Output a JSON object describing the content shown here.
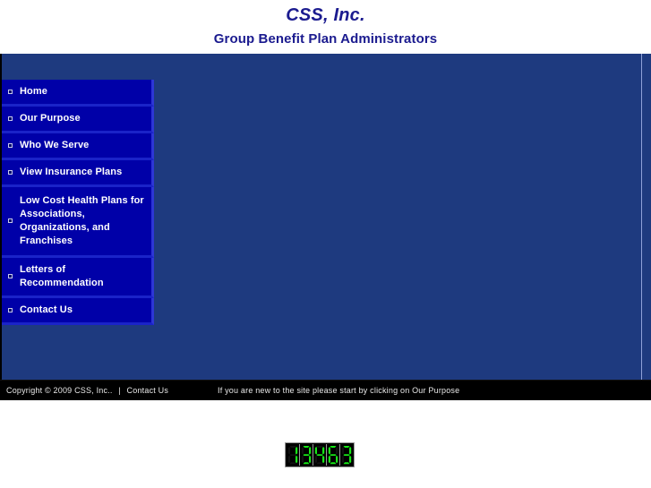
{
  "header": {
    "title": "CSS, Inc.",
    "tagline": "Group Benefit Plan Administrators",
    "title_color": "#1b1b8f"
  },
  "theme": {
    "page_background": "#1e3a7f",
    "nav_item_background": "#0000a8",
    "nav_item_border": "#2d36d6",
    "footer_background": "#000000",
    "counter_digit_color": "#17e817"
  },
  "nav": {
    "items": [
      {
        "label": "Home",
        "icon": "square-bullet-icon"
      },
      {
        "label": "Our Purpose",
        "icon": "square-bullet-icon"
      },
      {
        "label": "Who We Serve",
        "icon": "square-bullet-icon"
      },
      {
        "label": "View Insurance Plans",
        "icon": "square-bullet-icon"
      },
      {
        "label": "Low Cost Health Plans for Associations, Organizations, and Franchises",
        "icon": "square-bullet-icon"
      },
      {
        "label": "Letters of Recommendation",
        "icon": "square-bullet-icon"
      },
      {
        "label": "Contact Us",
        "icon": "square-bullet-icon"
      }
    ]
  },
  "footer": {
    "copyright": "Copyright © 2009  CSS, Inc..",
    "separator": "|",
    "contact_link": "Contact Us",
    "note": "If you are new to the site please start by clicking on Our Purpose"
  },
  "counter": {
    "value": "13463",
    "digits": [
      "1",
      "3",
      "4",
      "6",
      "3"
    ]
  }
}
